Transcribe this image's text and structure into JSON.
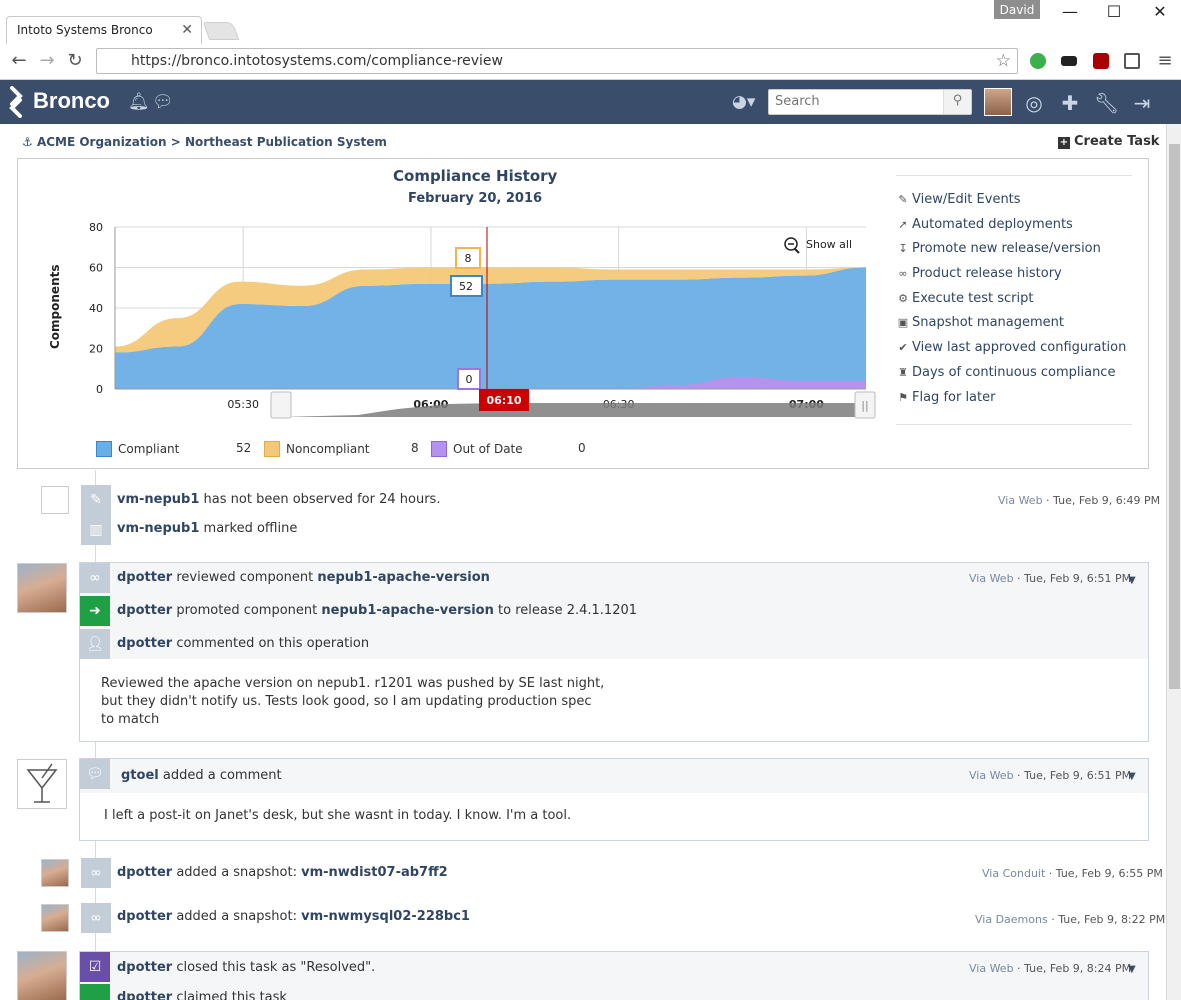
{
  "browser": {
    "tab_title": "Intoto Systems Bronco",
    "user": "David",
    "url": "https://bronco.intotosystems.com/compliance-review"
  },
  "app": {
    "name": "Bronco",
    "search_placeholder": "Search"
  },
  "breadcrumb": "ACME Organization > Northeast Publication System",
  "create_task": "Create Task",
  "chart": {
    "title": "Compliance History",
    "subtitle": "February 20, 2016",
    "ylabel": "Components",
    "show_all": "Show all",
    "cursor_time": "06:10",
    "tooltip_noncompliant": "8",
    "tooltip_compliant": "52",
    "tooltip_outofdate": "0",
    "legend": [
      {
        "label": "Compliant",
        "value": "52",
        "color": "#6aaee6"
      },
      {
        "label": "Noncompliant",
        "value": "8",
        "color": "#f3c878"
      },
      {
        "label": "Out of Date",
        "value": "0",
        "color": "#b493ee"
      }
    ]
  },
  "chart_data": {
    "type": "area",
    "title": "Compliance History",
    "subtitle": "February 20, 2016",
    "xlabel": "",
    "ylabel": "Components",
    "ylim": [
      0,
      80
    ],
    "yticks": [
      0,
      20,
      40,
      60,
      80
    ],
    "xticks": [
      "05:30",
      "06:00",
      "06:30",
      "07:00"
    ],
    "x": [
      "05:10",
      "05:20",
      "05:30",
      "05:40",
      "05:50",
      "06:00",
      "06:10",
      "06:20",
      "06:30",
      "06:40",
      "06:50",
      "07:00",
      "07:10"
    ],
    "series": [
      {
        "name": "Compliant",
        "values": [
          18,
          21,
          42,
          41,
          51,
          52,
          52,
          53,
          54,
          54,
          55,
          56,
          60
        ]
      },
      {
        "name": "Noncompliant",
        "values": [
          3,
          14,
          11,
          10,
          8,
          8,
          8,
          7,
          5,
          5,
          4,
          3,
          0
        ]
      },
      {
        "name": "Out of Date",
        "values": [
          0,
          0,
          0,
          0,
          0,
          0,
          0,
          0,
          0,
          2,
          6,
          4,
          4
        ]
      }
    ],
    "grid": true,
    "legend_position": "bottom-left"
  },
  "actions": [
    {
      "icon": "pencil-icon",
      "glyph": "✎",
      "label": "View/Edit Events"
    },
    {
      "icon": "rocket-icon",
      "glyph": "➚",
      "label": "Automated deployments"
    },
    {
      "icon": "level-down-icon",
      "glyph": "↧",
      "label": "Promote new release/version"
    },
    {
      "icon": "link-icon",
      "glyph": "∞",
      "label": "Product release history"
    },
    {
      "icon": "gear-icon",
      "glyph": "⚙",
      "label": "Execute test script"
    },
    {
      "icon": "camera-icon",
      "glyph": "▣",
      "label": "Snapshot management"
    },
    {
      "icon": "check-circle-icon",
      "glyph": "✔",
      "label": "View last approved configuration"
    },
    {
      "icon": "trophy-icon",
      "glyph": "♜",
      "label": "Days of continuous compliance"
    },
    {
      "icon": "flag-icon",
      "glyph": "⚑",
      "label": "Flag for later"
    }
  ],
  "feed": {
    "e1": {
      "host": "vm-nepub1",
      "text": " has not been observed for 24 hours.",
      "via": "Via Web",
      "time": " · Tue, Feb 9, 6:49 PM"
    },
    "e2": {
      "host": "vm-nepub1",
      "text": " marked offline"
    },
    "e3": {
      "user": "dpotter",
      "text": " reviewed component ",
      "component": "nepub1-apache-version",
      "via": "Via Web",
      "time": " · Tue, Feb 9, 6:51 PM"
    },
    "e4": {
      "user": "dpotter",
      "text": " promoted component ",
      "component": "nepub1-apache-version",
      "text2": " to release 2.4.1.1201"
    },
    "e5": {
      "user": "dpotter",
      "text": " commented on this operation"
    },
    "c1": [
      "Reviewed the apache version on nepub1.  r1201 was pushed by SE last night,",
      "but they didn't notify us.  Tests look good, so I am updating production spec",
      "to match"
    ],
    "e6": {
      "user": "gtoel",
      "text": " added a comment",
      "via": "Via Web",
      "time": " · Tue, Feb 9, 6:51 PM"
    },
    "c2": "I left a post-it on Janet's desk, but she wasnt in today.  I know. I'm a tool.",
    "e7": {
      "user": "dpotter",
      "text": " added a snapshot:  ",
      "snapshot": "vm-nwdist07-ab7ff2",
      "via": "Via Conduit",
      "time": " · Tue, Feb 9, 6:55 PM"
    },
    "e8": {
      "user": "dpotter",
      "text": " added a snapshot: ",
      "snapshot": "vm-nwmysql02-228bc1",
      "via": "Via Daemons",
      "time": " · Tue, Feb 9, 8:22 PM"
    },
    "e9": {
      "user": "dpotter",
      "text": " closed this task as \"Resolved\".",
      "via": "Via Web",
      "time": " · Tue, Feb 9, 8:24 PM"
    },
    "e10": {
      "user": "dpotter",
      "text": " claimed this task"
    }
  }
}
